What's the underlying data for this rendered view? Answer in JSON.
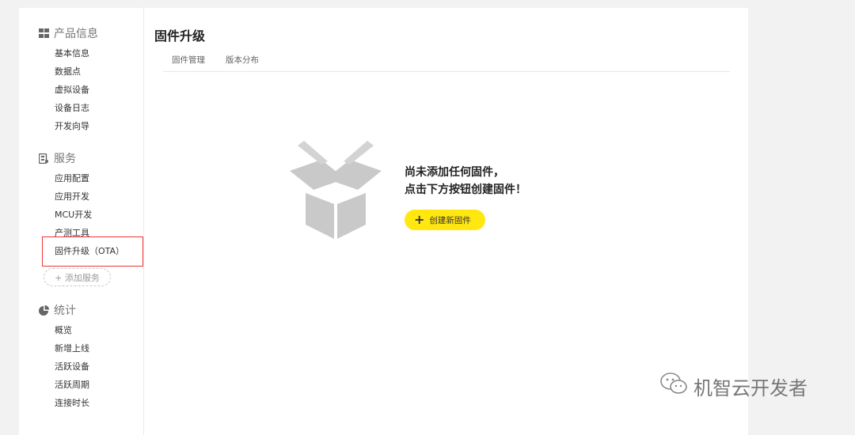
{
  "sidebar": {
    "product": {
      "title": "产品信息",
      "items": [
        "基本信息",
        "数据点",
        "虚拟设备",
        "设备日志",
        "开发向导"
      ]
    },
    "service": {
      "title": "服务",
      "items": [
        "应用配置",
        "应用开发",
        "MCU开发",
        "产测工具",
        "固件升级（OTA）"
      ],
      "add_label": "+ 添加服务"
    },
    "stats": {
      "title": "统计",
      "items": [
        "概览",
        "新增上线",
        "活跃设备",
        "活跃周期",
        "连接时长"
      ]
    }
  },
  "main": {
    "title": "固件升级",
    "tabs": [
      "固件管理",
      "版本分布"
    ],
    "empty_line1": "尚未添加任何固件，",
    "empty_line2": "点击下方按钮创建固件！",
    "create_button": "创建新固件"
  },
  "watermark": "机智云开发者",
  "colors": {
    "accent": "#ffe70f",
    "highlight_border": "#e33333",
    "box_gray": "#c9c9c9"
  }
}
